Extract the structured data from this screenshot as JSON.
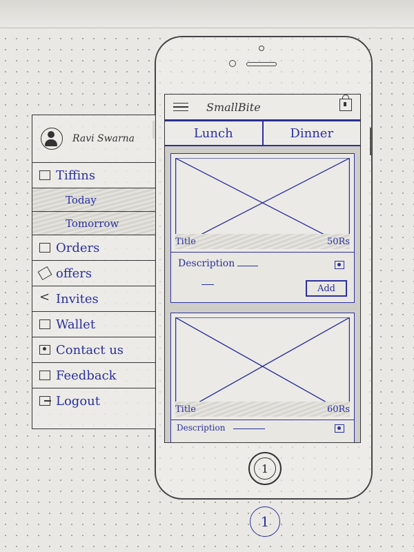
{
  "app": {
    "title": "SmallBite"
  },
  "tabs": [
    {
      "label": "Lunch"
    },
    {
      "label": "Dinner"
    }
  ],
  "cards": [
    {
      "title": "Title",
      "price": "50Rs",
      "description": "Description",
      "add_label": "Add"
    },
    {
      "title": "Title",
      "price": "60Rs",
      "description": "Description"
    }
  ],
  "drawer": {
    "profile_name": "Ravi Swarna",
    "items": [
      {
        "label": "Tiffins",
        "icon": "tiffin-icon"
      },
      {
        "label": "Today",
        "sub": true
      },
      {
        "label": "Tomorrow",
        "sub": true
      },
      {
        "label": "Orders",
        "icon": "orders-icon"
      },
      {
        "label": "offers",
        "icon": "tag-icon"
      },
      {
        "label": "Invites",
        "icon": "share-icon"
      },
      {
        "label": "Wallet",
        "icon": "wallet-icon"
      },
      {
        "label": "Contact us",
        "icon": "contact-icon"
      },
      {
        "label": "Feedback",
        "icon": "feedback-icon"
      },
      {
        "label": "Logout",
        "icon": "logout-icon"
      }
    ]
  },
  "home_button": {
    "label": "1"
  },
  "page_number": "1"
}
